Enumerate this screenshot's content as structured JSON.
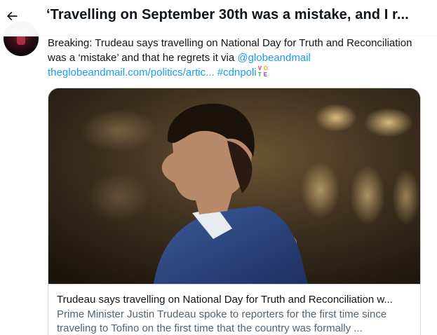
{
  "header": {
    "title": "‘Travelling on September 30th was a mistake, and I r..."
  },
  "tweet": {
    "text_plain_1": "Breaking: Trudeau says travelling on National Day for Truth and Reconciliation was a ‘mistake’ and that he regrets it via ",
    "mention": "@globeandmail",
    "url": "theglobeandmail.com/politics/artic...",
    "hashtag": "#cdnpoli",
    "emoji_letters": [
      "V",
      "O",
      "T",
      "E"
    ]
  },
  "card": {
    "title": "Trudeau says travelling on National Day for Truth and Reconciliation w...",
    "description": "Prime Minister Justin Trudeau spoke to reporters for the first time since traveling to Tofino on the first time that the country was formally ..."
  },
  "colors": {
    "link": "#1d9bf0",
    "text": "#0f1419",
    "secondary_text": "#536471",
    "border": "#cfd9de"
  },
  "icons": {
    "back": "arrow-left-icon"
  }
}
